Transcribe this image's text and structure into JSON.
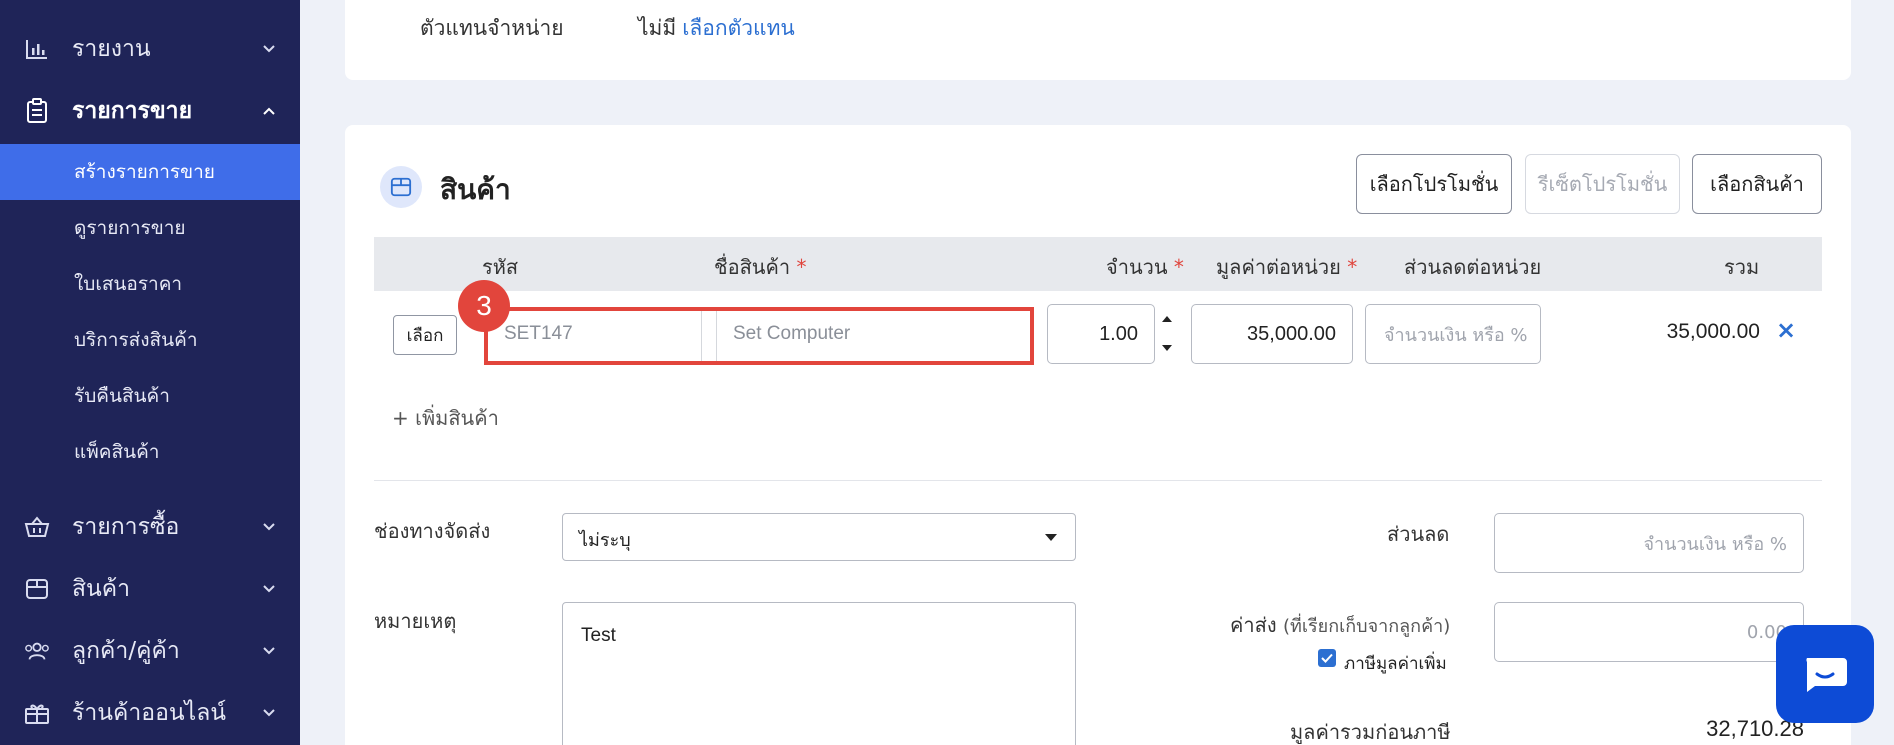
{
  "sidebar": {
    "reports": "รายงาน",
    "sales": "รายการขาย",
    "sales_sub": {
      "create": "สร้างรายการขาย",
      "view": "ดูรายการขาย",
      "quotation": "ใบเสนอราคา",
      "shipping": "บริการส่งสินค้า",
      "returns": "รับคืนสินค้า",
      "pack": "แพ็คสินค้า"
    },
    "purchases": "รายการซื้อ",
    "products": "สินค้า",
    "contacts": "ลูกค้า/คู่ค้า",
    "online_store": "ร้านค้าออนไลน์"
  },
  "agent": {
    "label": "ตัวแทนจำหน่าย",
    "value": "ไม่มี",
    "link": "เลือกตัวแทน"
  },
  "products_section": {
    "title": "สินค้า",
    "buttons": {
      "select_promo": "เลือกโปรโมชั่น",
      "reset_promo": "รีเซ็ตโปรโมชั่น",
      "select_product": "เลือกสินค้า"
    },
    "columns": {
      "code": "รหัส",
      "name": "ชื่อสินค้า",
      "qty": "จำนวน",
      "unit_price": "มูลค่าต่อหน่วย",
      "discount": "ส่วนลดต่อหน่วย",
      "total": "รวม",
      "required_mark": "*"
    },
    "row": {
      "select_label": "เลือก",
      "code_placeholder": "SET147",
      "name_placeholder": "Set Computer",
      "qty": "1.00",
      "unit_price": "35,000.00",
      "discount_placeholder": "จำนวนเงิน หรือ %",
      "total": "35,000.00",
      "remove": "×"
    },
    "add_product": "+ เพิ่มสินค้า",
    "step_number": "3"
  },
  "form": {
    "shipping_channel_label": "ช่องทางจัดส่ง",
    "shipping_channel_value": "ไม่ระบุ",
    "note_label": "หมายเหตุ",
    "note_value": "Test",
    "discount_label": "ส่วนลด",
    "discount_placeholder": "จำนวนเงิน หรือ %",
    "shipping_fee_label": "ค่าส่ง",
    "shipping_fee_note": "(ที่เรียกเก็บจากลูกค้า)",
    "shipping_fee_placeholder": "0.00",
    "vat_label": "ภาษีมูลค่าเพิ่ม",
    "vat_checked": true,
    "pretax_label": "มูลค่ารวมก่อนภาษี",
    "pretax_value": "32,710.28"
  },
  "colors": {
    "sidebar_bg": "#1f2458",
    "active_item": "#3f6de9",
    "link": "#2c6fd1",
    "highlight": "#e2453c",
    "chat_button": "#0d4bd6"
  }
}
